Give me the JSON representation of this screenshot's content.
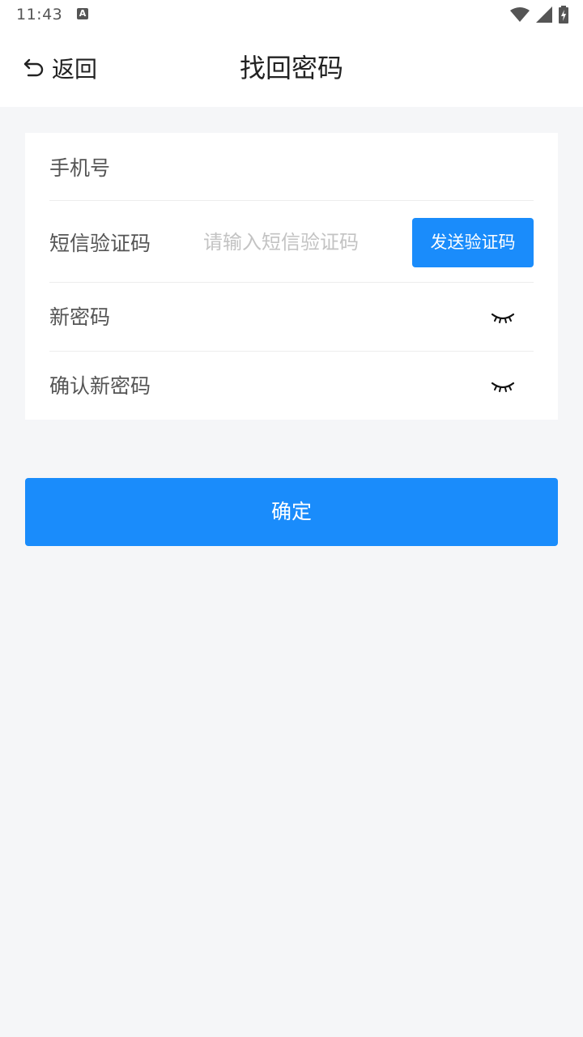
{
  "status_bar": {
    "time": "11:43",
    "notification_icon": "a-box-icon",
    "icons": [
      "wifi-icon",
      "cellular-signal-icon",
      "battery-charging-icon"
    ]
  },
  "nav": {
    "back_label": "返回",
    "back_icon": "undo-arrow-icon",
    "title": "找回密码"
  },
  "form": {
    "phone": {
      "label": "手机号",
      "value": "",
      "placeholder": ""
    },
    "sms_code": {
      "label": "短信验证码",
      "value": "",
      "placeholder": "请输入短信验证码"
    },
    "send_code_label": "发送验证码",
    "new_password": {
      "label": "新密码",
      "value": "",
      "placeholder": "",
      "toggle_icon": "eye-closed-icon"
    },
    "confirm_password": {
      "label": "确认新密码",
      "value": "",
      "placeholder": "",
      "toggle_icon": "eye-closed-icon"
    }
  },
  "confirm_label": "确定",
  "colors": {
    "accent": "#1a8cfb",
    "background": "#f5f6f8",
    "card": "#ffffff",
    "label_text": "#555555",
    "placeholder_text": "#c3c3c3"
  }
}
